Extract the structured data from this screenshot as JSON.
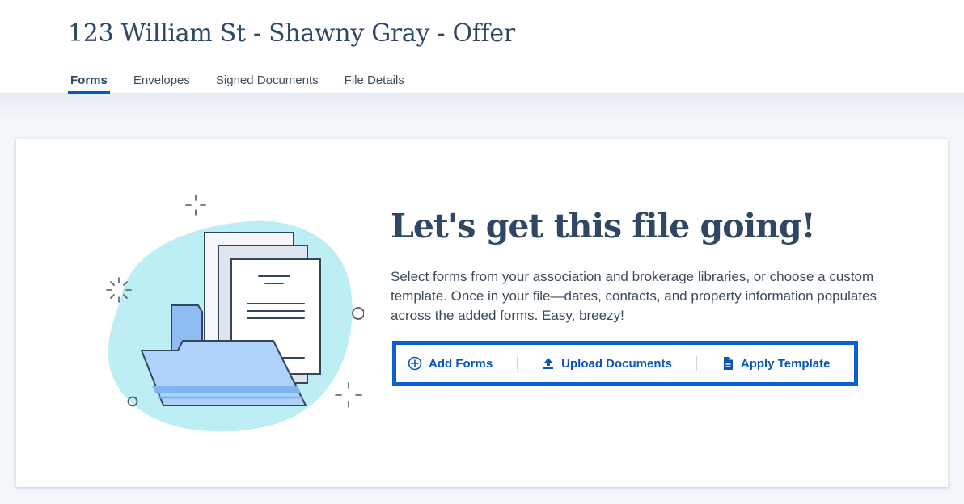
{
  "page": {
    "title": "123 William St - Shawny Gray - Offer"
  },
  "tabs": [
    {
      "label": "Forms",
      "active": true
    },
    {
      "label": "Envelopes",
      "active": false
    },
    {
      "label": "Signed Documents",
      "active": false
    },
    {
      "label": "File Details",
      "active": false
    }
  ],
  "empty_state": {
    "heading": "Let's get this file going!",
    "description": "Select forms from your association and brokerage libraries, or choose a custom template. Once in your file—dates, contacts, and property information populates across the added forms. Easy, breezy!",
    "illustration_icon": "folder-with-documents-icon"
  },
  "actions": [
    {
      "label": "Add Forms",
      "icon": "plus-circle-icon"
    },
    {
      "label": "Upload Documents",
      "icon": "upload-icon"
    },
    {
      "label": "Apply Template",
      "icon": "document-icon"
    }
  ],
  "colors": {
    "accent": "#0a61d1",
    "title": "#2f4763",
    "blob": "#bdeef3",
    "folder": "#a9cff7"
  }
}
